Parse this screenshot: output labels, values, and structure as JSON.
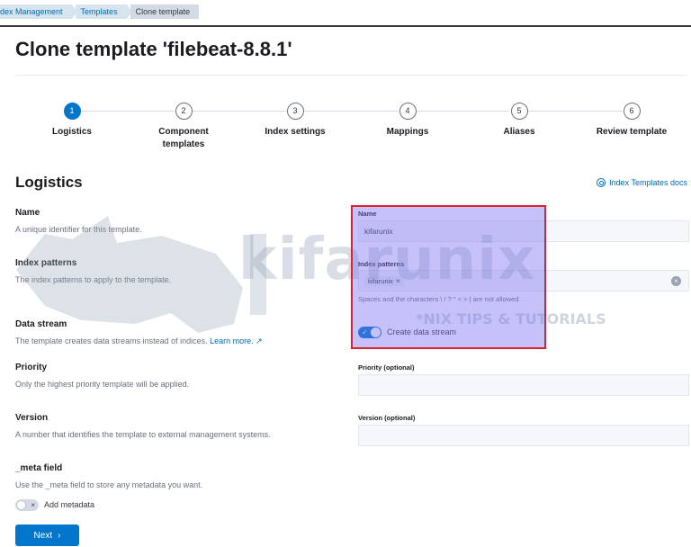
{
  "breadcrumbs": [
    {
      "label": "Index Management",
      "shown": "dex Management"
    },
    {
      "label": "Templates"
    },
    {
      "label": "Clone template"
    }
  ],
  "page_title": "Clone template 'filebeat-8.8.1'",
  "steps": [
    {
      "number": "1",
      "label": "Logistics",
      "active": true
    },
    {
      "number": "2",
      "label": "Component templates"
    },
    {
      "number": "3",
      "label": "Index settings"
    },
    {
      "number": "4",
      "label": "Mappings"
    },
    {
      "number": "5",
      "label": "Aliases"
    },
    {
      "number": "6",
      "label": "Review template"
    }
  ],
  "section": {
    "title": "Logistics",
    "docs_link": "Index Templates docs"
  },
  "fields": {
    "name": {
      "title": "Name",
      "desc": "A unique identifier for this template.",
      "label": "Name",
      "value": "kifarunix"
    },
    "index_patterns": {
      "title": "Index patterns",
      "desc": "The index patterns to apply to the template.",
      "label": "Index patterns",
      "pill": "kifarunix",
      "pill_remove": "×",
      "clear": "×",
      "help": "Spaces and the characters \\ / ? \" < > | are not allowed."
    },
    "data_stream": {
      "title": "Data stream",
      "desc": "The template creates data streams instead of indices.",
      "learn_more": "Learn more.",
      "switch_label": "Create data stream",
      "switch_glyph": "✓",
      "enabled": true
    },
    "priority": {
      "title": "Priority",
      "desc": "Only the highest priority template will be applied.",
      "label": "Priority (optional)",
      "value": ""
    },
    "version": {
      "title": "Version",
      "desc": "A number that identifies the template to external management systems.",
      "label": "Version (optional)",
      "value": ""
    },
    "meta": {
      "title": "_meta field",
      "desc": "Use the _meta field to store any metadata you want.",
      "switch_label": "Add metadata",
      "switch_glyph": "×",
      "enabled": false
    }
  },
  "next_button": {
    "label": "Next",
    "chevron": "›"
  },
  "watermark": {
    "text": "kifarunix",
    "subtext": "*NIX TIPS & TUTORIALS"
  },
  "colors": {
    "primary": "#0077cc",
    "link": "#006bb8",
    "highlight_border": "#e0202c",
    "highlight_fill": "#7c6ef0"
  }
}
